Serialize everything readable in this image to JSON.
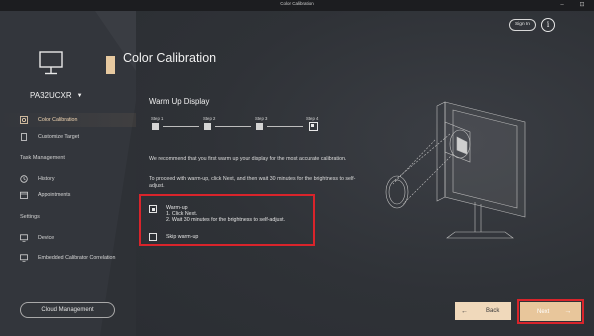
{
  "window": {
    "title": "Color Calibration",
    "min_glyph": "–",
    "restore_glyph": "⊡"
  },
  "sidebar": {
    "model": "PA32UCXR",
    "items": [
      {
        "label": "Color Calibration",
        "active": true,
        "icon": "calibration-icon"
      },
      {
        "label": "Customize Target",
        "active": false,
        "icon": "target-icon"
      }
    ],
    "task_management": {
      "heading": "Task Management",
      "items": [
        {
          "label": "History",
          "icon": "history-icon"
        },
        {
          "label": "Appointments",
          "icon": "calendar-icon"
        }
      ]
    },
    "settings": {
      "heading": "Settings",
      "items": [
        {
          "label": "Device",
          "icon": "monitor-icon"
        },
        {
          "label": "Embedded Calibrator Correlation",
          "icon": "monitor-icon"
        }
      ]
    },
    "cloud_button": "Cloud Management"
  },
  "header": {
    "title": "Color Calibration",
    "sign_in": "Sign In",
    "info_glyph": "i"
  },
  "main": {
    "subtitle": "Warm Up Display",
    "steps": [
      "Step 1",
      "Step 2",
      "Step 3",
      "Step 4"
    ],
    "current_step": 4,
    "para1": "We recommend that you first warm up your display for the most accurate calibration.",
    "para2": "To proceed with warm-up, click Next, and then wait 30 minutes for the brightness to self-adjust.",
    "options": {
      "warmup_title": "Warm-up",
      "warmup_line1": "1. Click Next.",
      "warmup_line2": "2. Wait 30 minutes for the brightness to self-adjust.",
      "warmup_checked": true,
      "skip_label": "Skip warm-up",
      "skip_checked": false
    }
  },
  "footer": {
    "back": "Back",
    "next": "Next",
    "back_arrow": "←",
    "next_arrow": "→"
  },
  "colors": {
    "accent": "#e8c69b",
    "highlight": "#d9242b",
    "background": "#2b2e33"
  }
}
